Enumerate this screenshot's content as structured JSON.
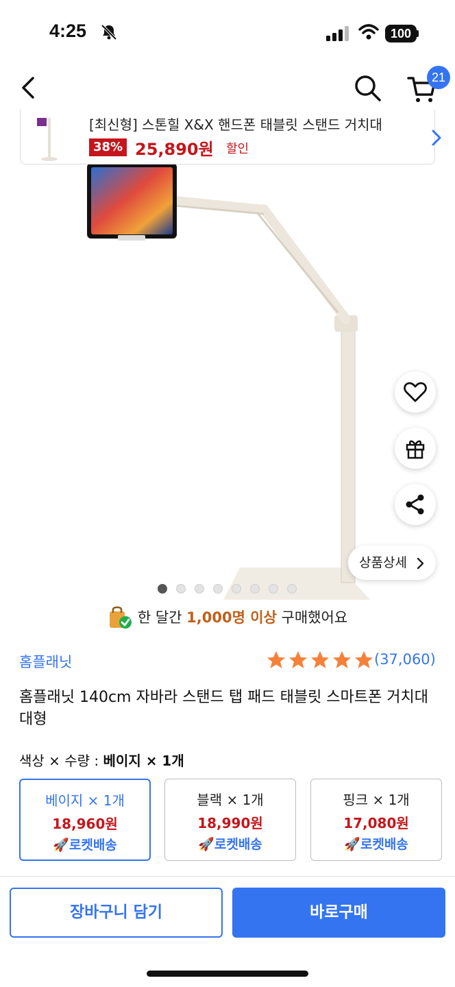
{
  "status": {
    "time": "4:25",
    "battery": "100"
  },
  "nav": {
    "cart_count": "21"
  },
  "banner": {
    "title": "[최신형] 스톤힐 X&X 핸드폰 태블릿 스탠드 거치대",
    "discount": "38%",
    "price": "25,890원",
    "sale_word": "할인"
  },
  "gallery": {
    "detail_label": "상품상세",
    "dot_count": 8,
    "active_dot": 0
  },
  "notice": {
    "prefix": "한 달간 ",
    "highlight": "1,000명 이상",
    "suffix": " 구매했어요"
  },
  "product": {
    "brand": "홈플래닛",
    "rating": 5,
    "review_count": "(37,060)",
    "title": "홈플래닛 140cm 자바라 스탠드 탭 패드 태블릿 스마트폰 거치대 대형"
  },
  "options": {
    "label_prefix": "색상 × 수량 : ",
    "label_value": "베이지 × 1개",
    "items": [
      {
        "name": "베이지 × 1개",
        "price": "18,960원",
        "shipping": "🚀로켓배송",
        "selected": true
      },
      {
        "name": "블랙 × 1개",
        "price": "18,990원",
        "shipping": "🚀로켓배송",
        "selected": false
      },
      {
        "name": "핑크 × 1개",
        "price": "17,080원",
        "shipping": "🚀로켓배송",
        "selected": false
      }
    ]
  },
  "actions": {
    "cart_label": "장바구니 담기",
    "buy_label": "바로구매"
  },
  "colors": {
    "accent": "#3474f0",
    "price": "#c4161c",
    "star": "#f5813a",
    "highlight": "#c0611b"
  },
  "icons": [
    "bell-slash-icon",
    "signal-icon",
    "wifi-icon",
    "back-arrow-icon",
    "search-icon",
    "cart-icon",
    "heart-icon",
    "gift-icon",
    "share-icon",
    "chevron-right-icon",
    "shopping-bag-check-icon",
    "star-icon"
  ]
}
